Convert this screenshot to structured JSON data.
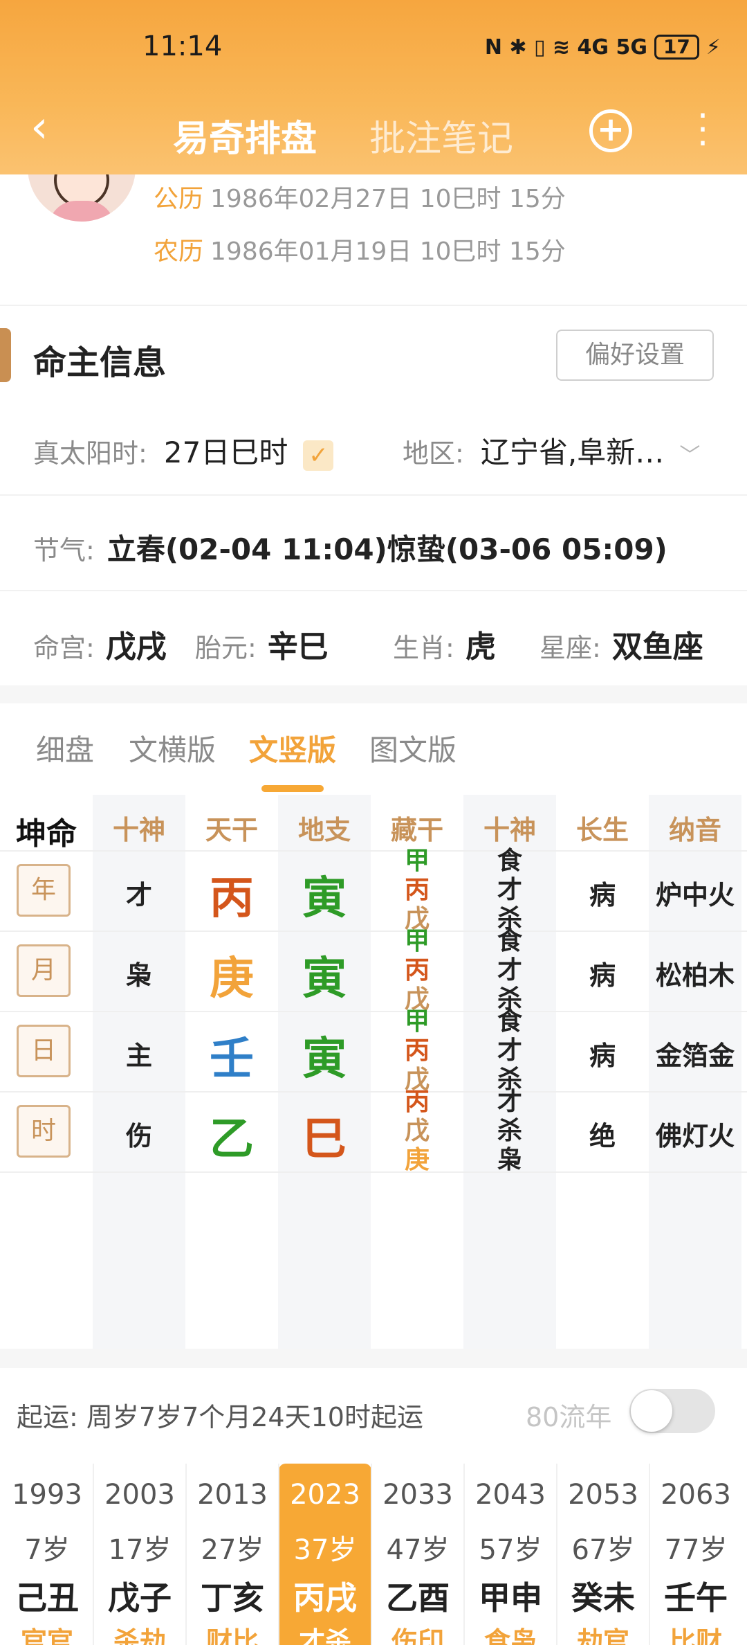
{
  "status_bar": {
    "time": "11:14",
    "icons_text": "N ✱ ▯ ≋ 4G 5G",
    "battery": "17"
  },
  "nav": {
    "title": "易奇排盘",
    "tab2": "批注笔记",
    "add_icon": "plus-circle-icon",
    "more_icon": "more-vertical-icon"
  },
  "profile": {
    "solar_label": "公历",
    "solar_value": "1986年02月27日 10巳时 15分",
    "lunar_label": "农历",
    "lunar_value": "1986年01月19日 10巳时 15分"
  },
  "section": {
    "title": "命主信息",
    "pref_button": "偏好设置"
  },
  "true_solar": {
    "label": "真太阳时:",
    "value": "27日巳时",
    "checked": true
  },
  "region": {
    "label": "地区:",
    "value": "辽宁省,阜新…"
  },
  "jieqi": {
    "label": "节气:",
    "value": "立春(02-04 11:04)惊蛰(03-06 05:09)"
  },
  "gong": [
    {
      "label": "命宫:",
      "value": "戊戌"
    },
    {
      "label": "胎元:",
      "value": "辛巳"
    },
    {
      "label": "生肖:",
      "value": "虎"
    },
    {
      "label": "星座:",
      "value": "双鱼座"
    }
  ],
  "view_tabs": [
    "细盘",
    "文横版",
    "文竖版",
    "图文版"
  ],
  "active_view": "文竖版",
  "table": {
    "corner": "坤命",
    "headers": [
      "十神",
      "天干",
      "地支",
      "藏干",
      "十神",
      "长生",
      "纳音"
    ],
    "rows": [
      {
        "pillar": "年",
        "shishen": "才",
        "gan": "丙",
        "zhi": "寅",
        "canggan": [
          "甲",
          "丙",
          "戊"
        ],
        "cang_shishen": [
          "食",
          "才",
          "杀"
        ],
        "changsheng": "病",
        "nayin": "炉中火"
      },
      {
        "pillar": "月",
        "shishen": "枭",
        "gan": "庚",
        "zhi": "寅",
        "canggan": [
          "甲",
          "丙",
          "戊"
        ],
        "cang_shishen": [
          "食",
          "才",
          "杀"
        ],
        "changsheng": "病",
        "nayin": "松柏木"
      },
      {
        "pillar": "日",
        "shishen": "主",
        "gan": "壬",
        "zhi": "寅",
        "canggan": [
          "甲",
          "丙",
          "戊"
        ],
        "cang_shishen": [
          "食",
          "才",
          "杀"
        ],
        "changsheng": "病",
        "nayin": "金箔金"
      },
      {
        "pillar": "时",
        "shishen": "伤",
        "gan": "乙",
        "zhi": "巳",
        "canggan": [
          "丙",
          "戊",
          "庚"
        ],
        "cang_shishen": [
          "才",
          "杀",
          "枭"
        ],
        "changsheng": "绝",
        "nayin": "佛灯火"
      }
    ],
    "colors": {
      "fire": "#d4561b",
      "metal": "#f2a33a",
      "water": "#2f7fc8",
      "wood": "#2e9b27",
      "earth": "#c8935a"
    }
  },
  "qiyun": {
    "label": "起运:",
    "value": "周岁7岁7个月24天10时起运",
    "liunian_label": "80流年",
    "toggle_on": false
  },
  "dayun": [
    {
      "year": "1993",
      "age": "7岁",
      "ganzhi": "己丑",
      "shishen": "官官"
    },
    {
      "year": "2003",
      "age": "17岁",
      "ganzhi": "戊子",
      "shishen": "杀劫"
    },
    {
      "year": "2013",
      "age": "27岁",
      "ganzhi": "丁亥",
      "shishen": "财比"
    },
    {
      "year": "2023",
      "age": "37岁",
      "ganzhi": "丙戌",
      "shishen": "才杀"
    },
    {
      "year": "2033",
      "age": "47岁",
      "ganzhi": "乙酉",
      "shishen": "伤印"
    },
    {
      "year": "2043",
      "age": "57岁",
      "ganzhi": "甲申",
      "shishen": "食枭"
    },
    {
      "year": "2053",
      "age": "67岁",
      "ganzhi": "癸未",
      "shishen": "劫官"
    },
    {
      "year": "2063",
      "age": "77岁",
      "ganzhi": "壬午",
      "shishen": "比财"
    }
  ],
  "active_dayun_index": 3
}
